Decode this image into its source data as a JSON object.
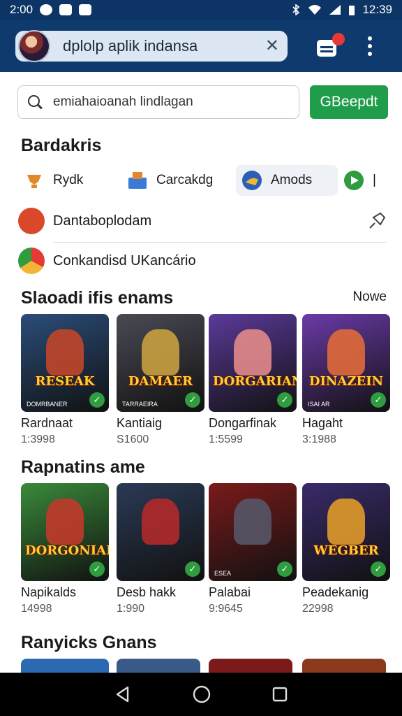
{
  "status_bar": {
    "time_left": "2:00",
    "time_right": "12:39"
  },
  "app_bar": {
    "url_text": "dplolp aplik indansa",
    "close_icon": "close-icon",
    "tabs_icon": "tabs-icon",
    "menu_icon": "more-vert-icon"
  },
  "search": {
    "value": "emiahaioanah lindlagan",
    "button_label": "GBeepdt"
  },
  "categories": {
    "title": "Bardakris",
    "items": [
      {
        "label": "Rydk",
        "icon": "trophy-icon",
        "color": "#e0892a"
      },
      {
        "label": "Carcakdg",
        "icon": "store-icon",
        "color": "#3a7bd5"
      },
      {
        "label": "Amods",
        "icon": "globe-icon",
        "color": "#2b5fb8"
      },
      {
        "label": "|",
        "icon": "play-icon",
        "color": "#2e9c3f"
      }
    ]
  },
  "list_rows": [
    {
      "label": "Dantaboplodam",
      "icon": "download-icon",
      "color": "#d9482b"
    },
    {
      "label": "Conkandisd UKancário",
      "icon": "chrome-icon",
      "color": "#3a8fd5"
    }
  ],
  "section1": {
    "title": "Slaoadi ifis enams",
    "more": "Nowe",
    "cards": [
      {
        "word": "RESEAK",
        "tag": "DOMRBANER",
        "name": "Rardnaat",
        "sub": "1:3998",
        "bg": "#2b4d7a",
        "accent": "#c0462a"
      },
      {
        "word": "DAMAER",
        "tag": "TARRAEIRA",
        "name": "Kantiaig",
        "sub": "S1600",
        "bg": "#4a4a55",
        "accent": "#c8a040"
      },
      {
        "word": "DORGARIAN",
        "tag": "",
        "name": "Dongarfinak",
        "sub": "1:5599",
        "bg": "#5b3a9a",
        "accent": "#e28a8a"
      },
      {
        "word": "DINAZEIN",
        "tag": "ISAI AR",
        "name": "Hagaht",
        "sub": "3:1988",
        "bg": "#6a3aa8",
        "accent": "#e06a3a"
      }
    ]
  },
  "section2": {
    "title": "Rapnatins ame",
    "cards": [
      {
        "word": "DORGONIAR",
        "tag": "",
        "name": "Napikalds",
        "sub": "14998",
        "bg": "#3a8a3a",
        "accent": "#c03a2a"
      },
      {
        "word": "",
        "tag": "",
        "name": "Desb hakk",
        "sub": "1:990",
        "bg": "#2a3a55",
        "accent": "#b02a2a"
      },
      {
        "word": "",
        "tag": "ESEA",
        "name": "Palabai",
        "sub": "9:9645",
        "bg": "#7a1a1a",
        "accent": "#555566"
      },
      {
        "word": "WEGBER",
        "tag": "",
        "name": "Peadekanig",
        "sub": "22998",
        "bg": "#3a2a6a",
        "accent": "#e09a2a"
      }
    ]
  },
  "section3": {
    "title": "Ranyicks Gnans"
  },
  "nav": {
    "back": "back-icon",
    "home": "home-icon",
    "recents": "recents-icon"
  }
}
